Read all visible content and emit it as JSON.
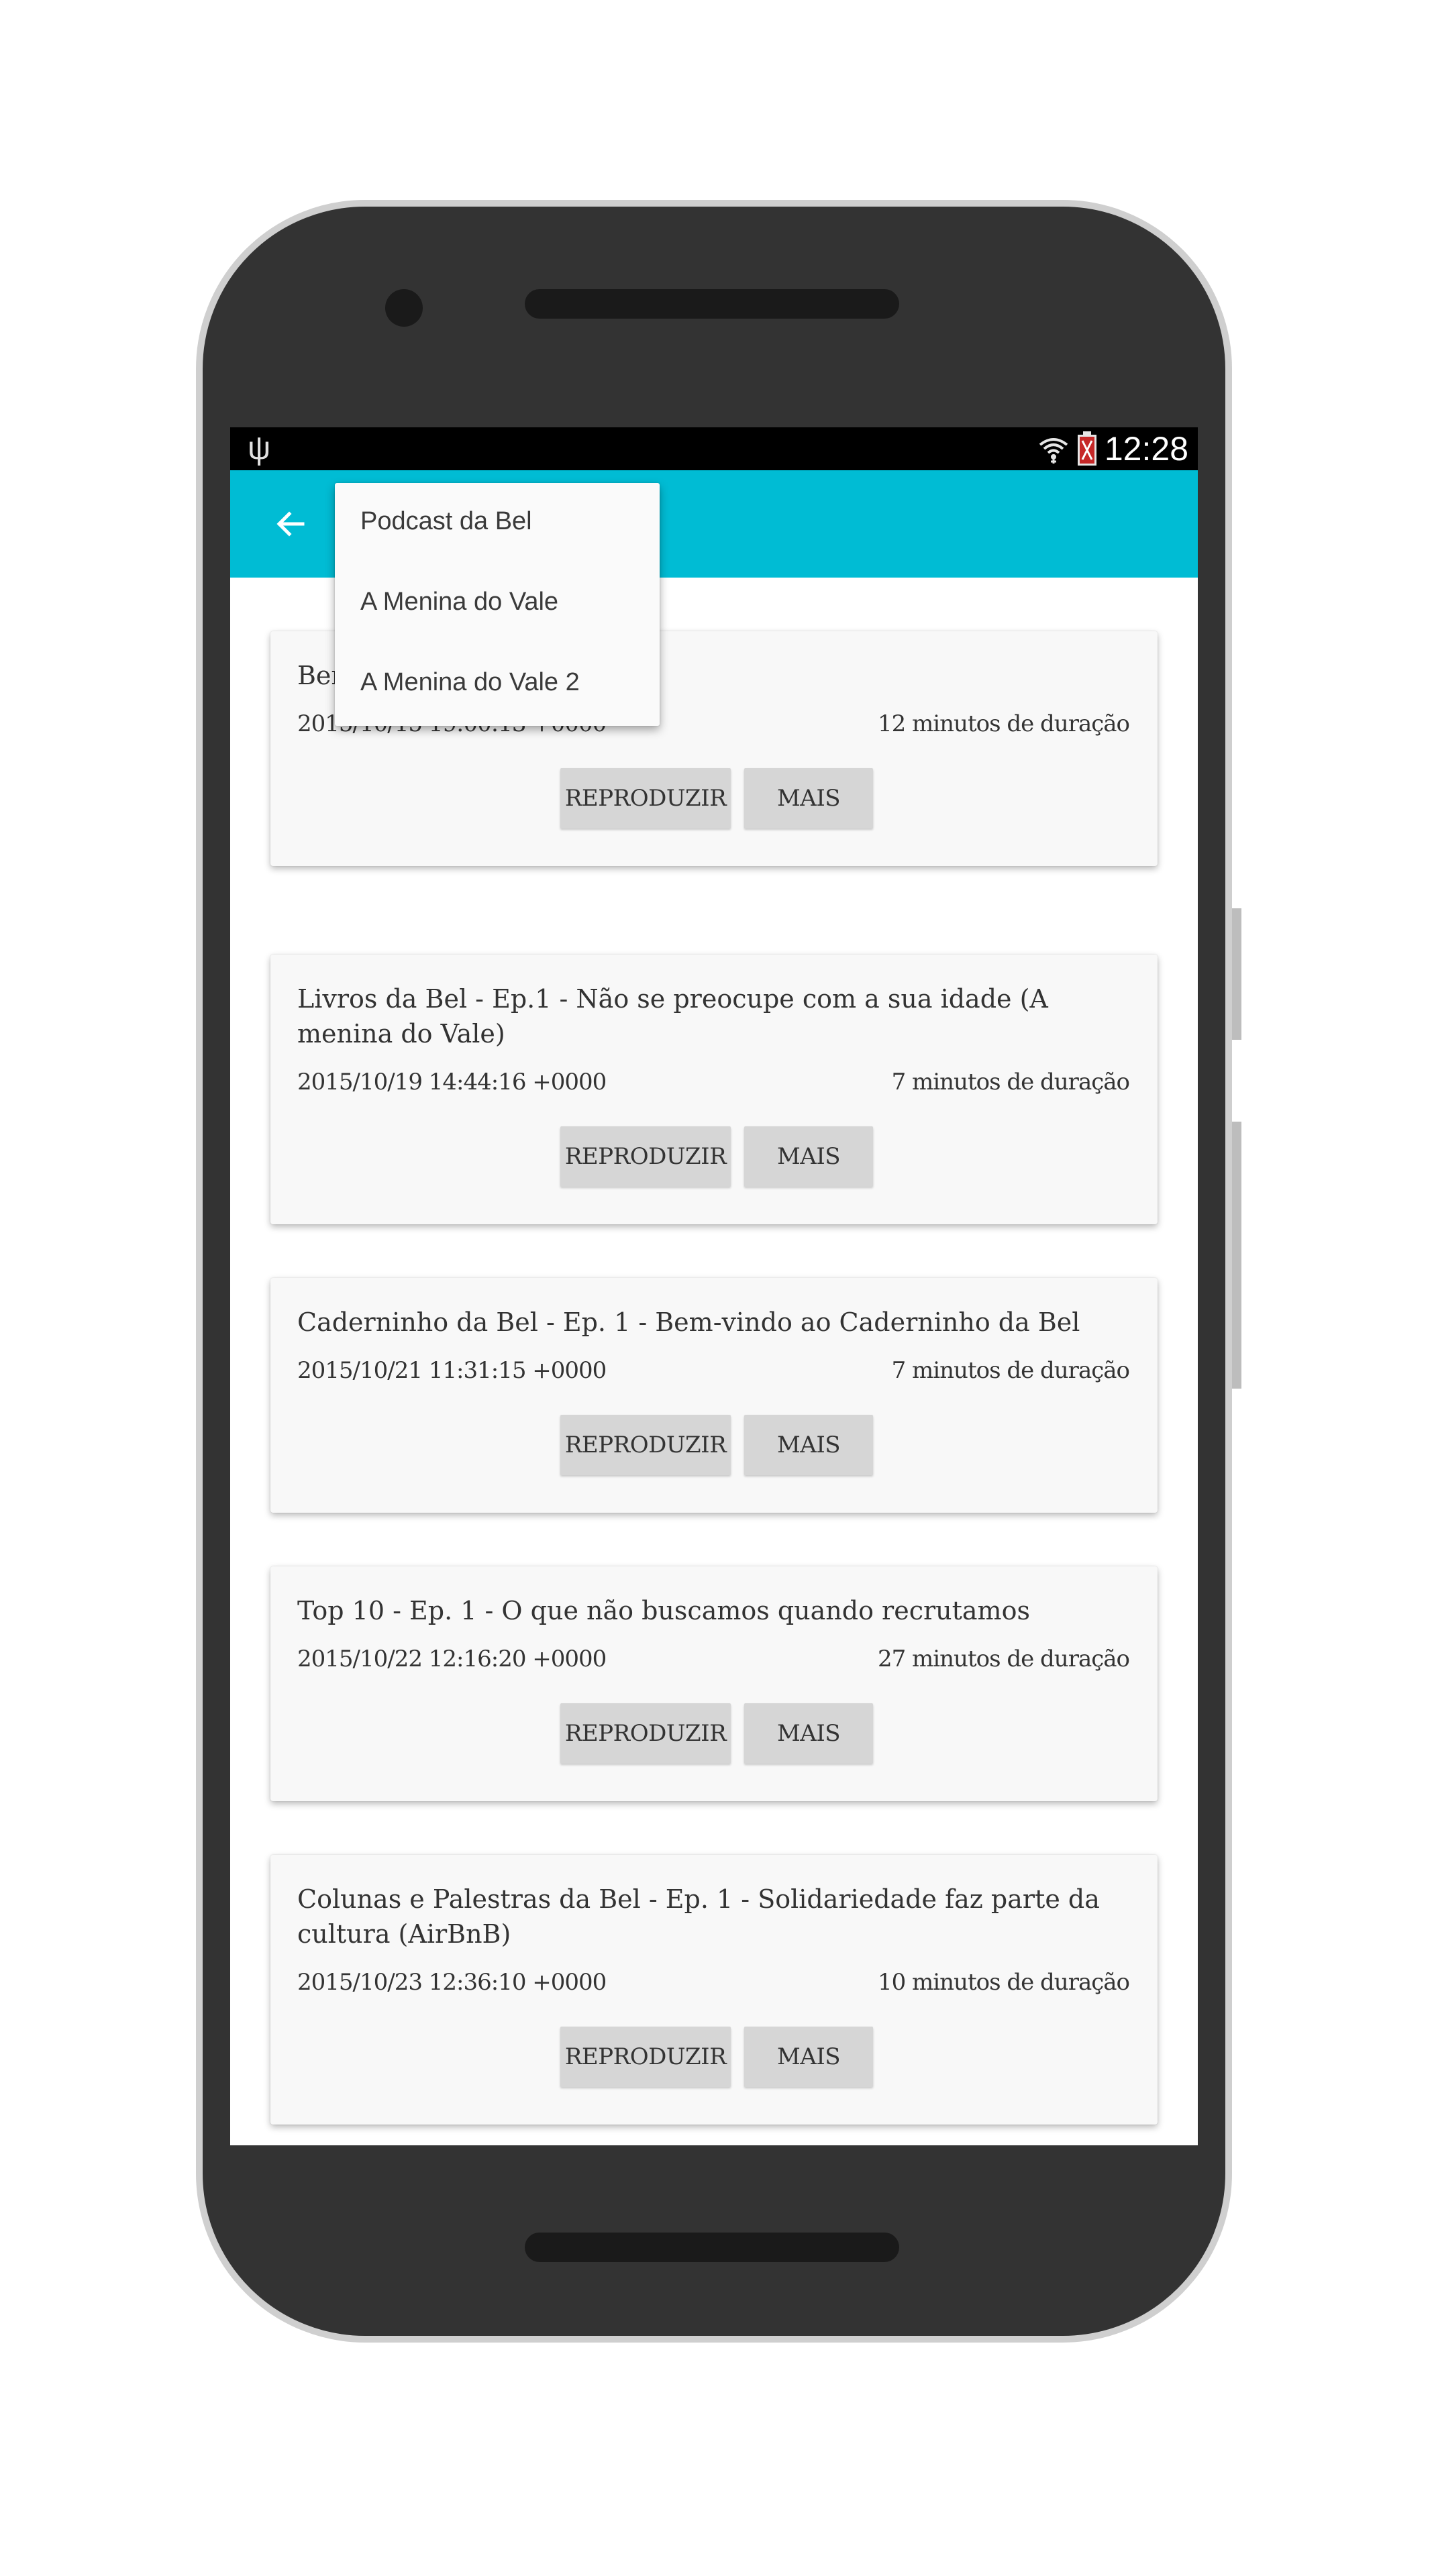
{
  "status_bar": {
    "time": "12:28",
    "usb_icon": "usb-icon",
    "wifi_icon": "wifi-icon",
    "battery_icon": "battery-alert-icon"
  },
  "app_bar": {
    "back_icon": "arrow-back-icon",
    "color": "#00bcd4"
  },
  "dropdown": {
    "items": [
      {
        "label": "Podcast da Bel"
      },
      {
        "label": "A Menina do Vale"
      },
      {
        "label": "A Menina do Vale 2"
      }
    ]
  },
  "episodes": [
    {
      "title": "Ben",
      "date": "2015/10/15 19:00:13 +0000",
      "duration": "12 minutos de duração",
      "play_label": "REPRODUZIR",
      "more_label": "MAIS"
    },
    {
      "title": "Livros da Bel - Ep.1 - Não se preocupe com a sua idade (A menina do Vale)",
      "date": "2015/10/19 14:44:16 +0000",
      "duration": "7 minutos de duração",
      "play_label": "REPRODUZIR",
      "more_label": "MAIS"
    },
    {
      "title": "Caderninho da Bel - Ep. 1 - Bem-vindo ao Caderninho da Bel",
      "date": "2015/10/21 11:31:15 +0000",
      "duration": "7 minutos de duração",
      "play_label": "REPRODUZIR",
      "more_label": "MAIS"
    },
    {
      "title": "Top 10 - Ep. 1 - O que não buscamos quando recrutamos",
      "date": "2015/10/22 12:16:20 +0000",
      "duration": "27 minutos de duração",
      "play_label": "REPRODUZIR",
      "more_label": "MAIS"
    },
    {
      "title": "Colunas e Palestras da Bel - Ep. 1 - Solidariedade faz parte da cultura (AirBnB)",
      "date": "2015/10/23 12:36:10 +0000",
      "duration": "10 minutos de duração",
      "play_label": "REPRODUZIR",
      "more_label": "MAIS"
    }
  ]
}
